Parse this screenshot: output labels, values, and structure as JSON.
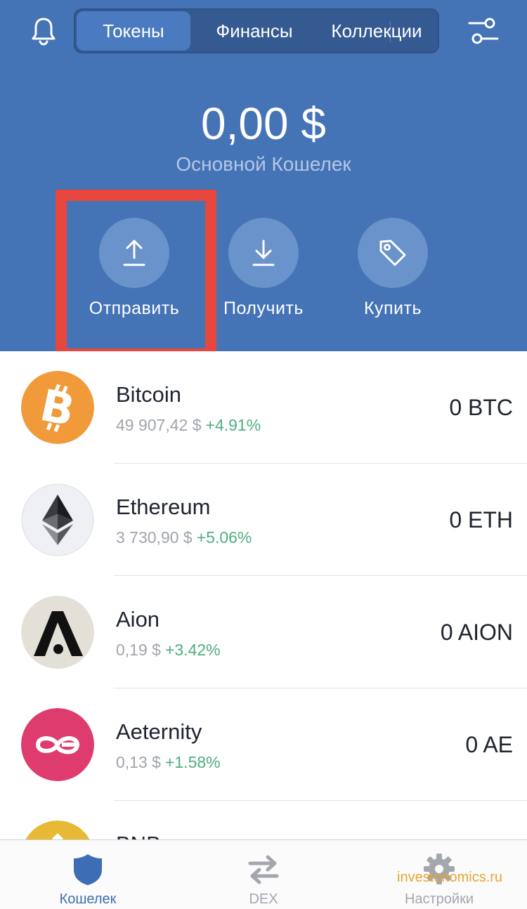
{
  "header": {
    "segments": [
      {
        "label": "Токены",
        "active": true
      },
      {
        "label": "Финансы",
        "active": false
      },
      {
        "label": "Коллекции",
        "active": false
      }
    ],
    "balance": "0,00 $",
    "wallet_name": "Основной Кошелек",
    "bell_icon": "bell-icon",
    "settings_icon": "sliders-icon"
  },
  "actions": [
    {
      "label": "Отправить",
      "icon": "upload-arrow-icon"
    },
    {
      "label": "Получить",
      "icon": "download-arrow-icon"
    },
    {
      "label": "Купить",
      "icon": "tag-icon"
    }
  ],
  "tokens": [
    {
      "name": "Bitcoin",
      "price": "49 907,42 $",
      "change": "+4.91%",
      "balance": "0 BTC",
      "icon": "bitcoin-logo-icon",
      "color": "#f09a3a"
    },
    {
      "name": "Ethereum",
      "price": "3 730,90 $",
      "change": "+5.06%",
      "balance": "0 ETH",
      "icon": "ethereum-logo-icon",
      "color": "#eef0f3"
    },
    {
      "name": "Aion",
      "price": "0,19 $",
      "change": "+3.42%",
      "balance": "0 AION",
      "icon": "aion-logo-icon",
      "color": "#e3e0d8"
    },
    {
      "name": "Aeternity",
      "price": "0,13 $",
      "change": "+1.58%",
      "balance": "0 AE",
      "icon": "aeternity-logo-icon",
      "color": "#de3b6e"
    },
    {
      "name": "BNB",
      "price": "",
      "change": "",
      "balance": "",
      "icon": "bnb-logo-icon",
      "color": "#e8b935"
    }
  ],
  "tabbar": [
    {
      "label": "Кошелек",
      "icon": "shield-icon",
      "active": true
    },
    {
      "label": "DEX",
      "icon": "swap-arrows-icon",
      "active": false
    },
    {
      "label": "Настройки",
      "icon": "gear-icon",
      "active": false
    }
  ],
  "watermark": "investonomics.ru",
  "colors": {
    "header_bg": "#4473b6",
    "accent": "#3d6eb5",
    "positive": "#4fae7d",
    "highlight": "#e8473e"
  }
}
